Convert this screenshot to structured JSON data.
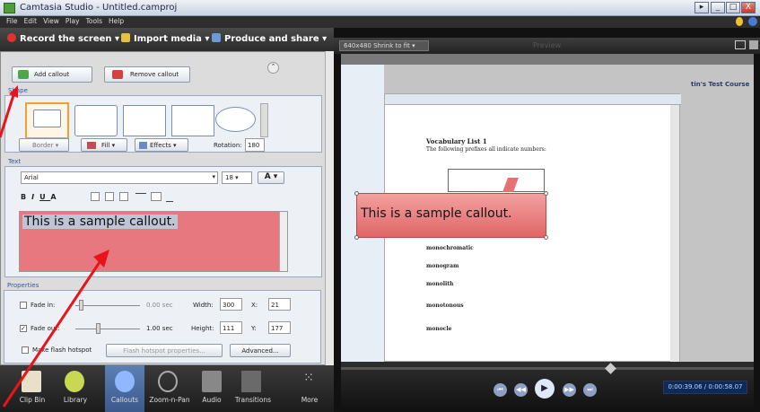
{
  "window": {
    "title": "Camtasia Studio - Untitled.camproj",
    "min": "_",
    "max": "□",
    "close": "X",
    "left_btn": "▸"
  },
  "menu": [
    "File",
    "Edit",
    "View",
    "Play",
    "Tools",
    "Help"
  ],
  "tasks": {
    "record": "Record the screen",
    "import": "Import media",
    "produce": "Produce and share"
  },
  "callouts": {
    "add": "Add callout",
    "remove": "Remove callout"
  },
  "shape": {
    "label": "Shape",
    "border": "Border",
    "fill": "Fill",
    "effects": "Effects",
    "rotation_label": "Rotation:",
    "rotation": "180"
  },
  "text": {
    "label": "Text",
    "font": "Arial",
    "size": "18",
    "color_btn": "A",
    "sample": "This is a sample callout.",
    "fmt": [
      "B",
      "I",
      "U",
      "A"
    ]
  },
  "properties": {
    "label": "Properties",
    "fade_in": "Fade in:",
    "fade_in_value": "0.00 sec",
    "fade_out": "Fade out:",
    "fade_out_value": "1.00 sec",
    "width_label": "Width:",
    "width": "300",
    "height_label": "Height:",
    "height": "111",
    "x_label": "X:",
    "x": "21",
    "y_label": "Y:",
    "y": "177",
    "flash_hotspot": "Make flash hotspot",
    "flash_props": "Flash hotspot properties...",
    "advanced": "Advanced..."
  },
  "task_nav": [
    "Clip Bin",
    "Library",
    "Callouts",
    "Zoom-n-Pan",
    "Audio",
    "Transitions",
    "More"
  ],
  "preview": {
    "size_select": "640x480 Shrink to fit",
    "title": "Preview",
    "time": "0:00:39.06 / 0:00:58.07"
  },
  "doc": {
    "heading": "Vocabulary List 1",
    "line2": "The following prefixes all indicate numbers:",
    "word1": "monochromatic",
    "word2": "monogram",
    "word3": "monolith",
    "word4": "monotonous",
    "word5": "monocle",
    "site_title": "tin's Test Course"
  }
}
